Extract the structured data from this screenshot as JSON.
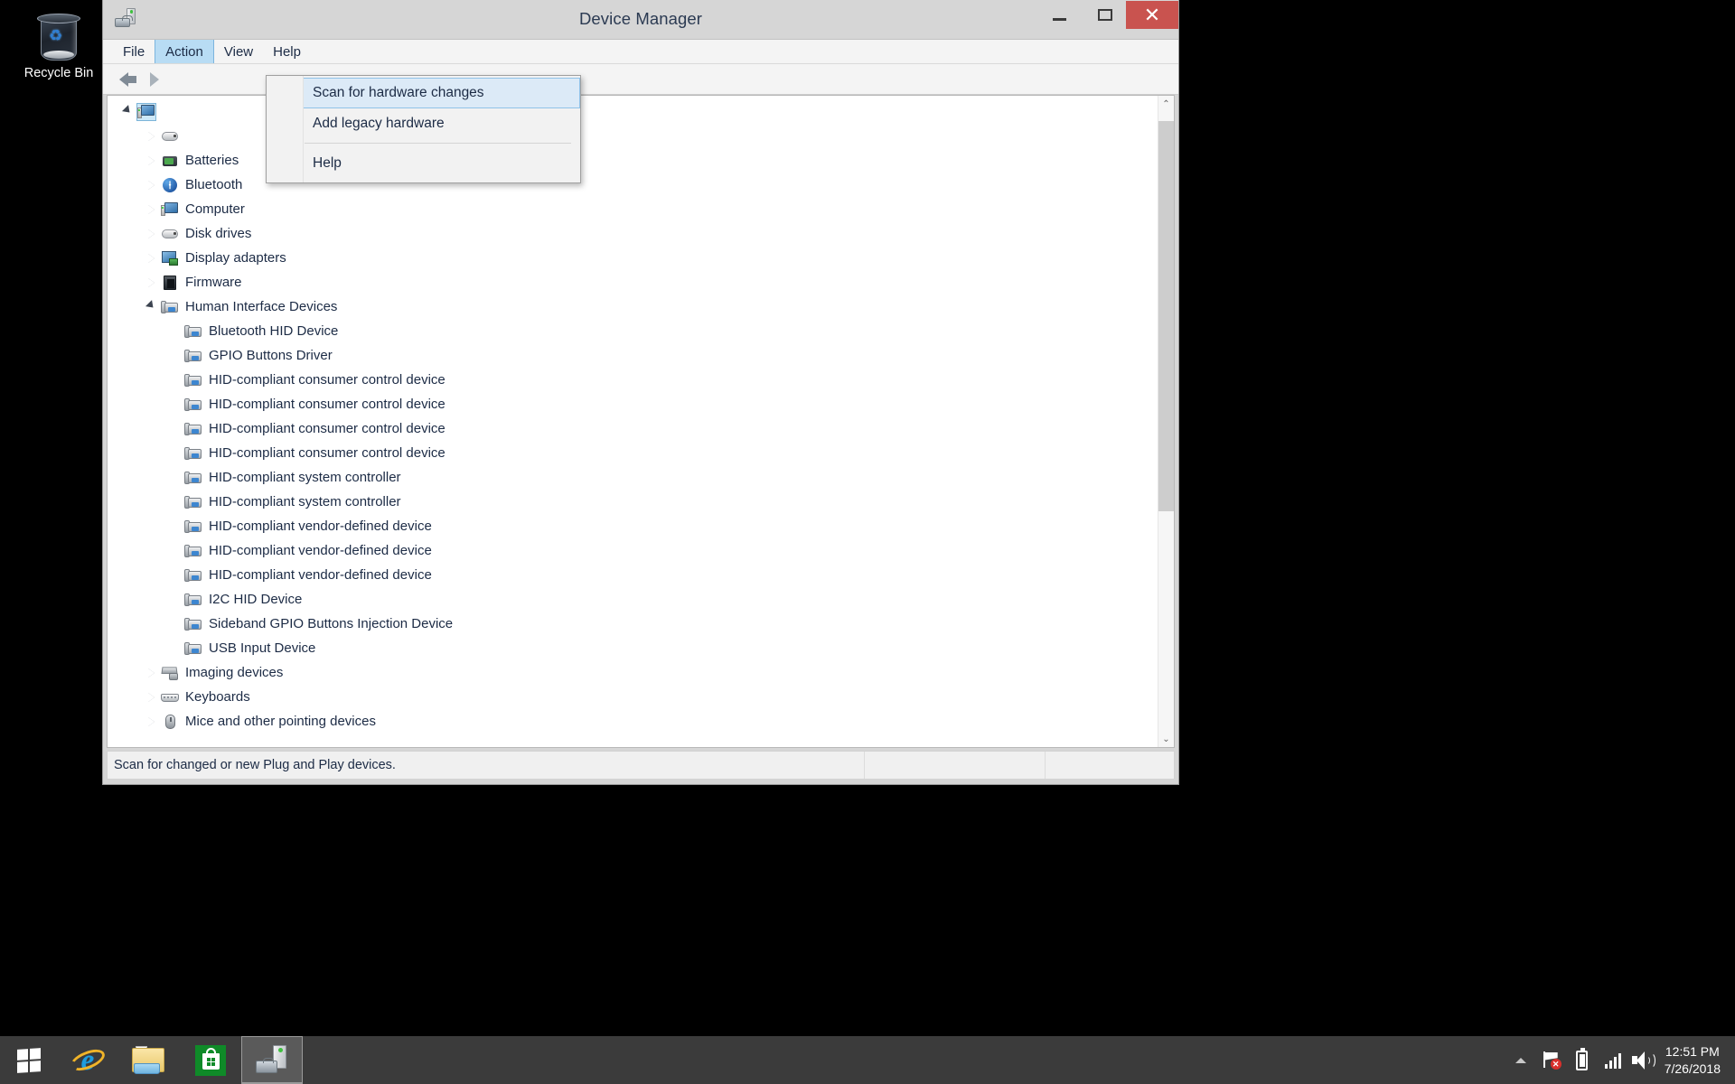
{
  "desktop": {
    "recycle_bin_label": "Recycle Bin",
    "recycle_bin_icon": "recycle-bin-icon"
  },
  "window": {
    "title": "Device Manager",
    "titlebar_icon": "device-manager-icon",
    "controls": {
      "minimize": "–",
      "maximize": "□",
      "close": "✕"
    }
  },
  "menu_bar": {
    "items": [
      {
        "label": "File",
        "open": false
      },
      {
        "label": "Action",
        "open": true
      },
      {
        "label": "View",
        "open": false
      },
      {
        "label": "Help",
        "open": false
      }
    ]
  },
  "action_menu": {
    "items": [
      {
        "label": "Scan for hardware changes",
        "highlighted": true,
        "separator_after": false
      },
      {
        "label": "Add legacy hardware",
        "highlighted": false,
        "separator_after": true
      },
      {
        "label": "Help",
        "highlighted": false,
        "separator_after": false
      }
    ]
  },
  "toolbar": {
    "back_icon": "back-arrow-icon",
    "forward_icon": "forward-arrow-icon"
  },
  "tree": {
    "rows": [
      {
        "label": "",
        "indent": 0,
        "twisty": "open",
        "icon": "computer-root-icon",
        "selected": true,
        "occluded": true
      },
      {
        "label": "",
        "indent": 1,
        "twisty": "closed",
        "icon": "audio-icon",
        "selected": false,
        "occluded": true
      },
      {
        "label": "Batteries",
        "indent": 1,
        "twisty": "closed",
        "icon": "battery-icon",
        "selected": false,
        "occluded": true
      },
      {
        "label": "Bluetooth",
        "indent": 1,
        "twisty": "closed",
        "icon": "bluetooth-icon",
        "selected": false,
        "occluded": false
      },
      {
        "label": "Computer",
        "indent": 1,
        "twisty": "closed",
        "icon": "computer-icon",
        "selected": false,
        "occluded": false
      },
      {
        "label": "Disk drives",
        "indent": 1,
        "twisty": "closed",
        "icon": "disk-drive-icon",
        "selected": false,
        "occluded": false
      },
      {
        "label": "Display adapters",
        "indent": 1,
        "twisty": "closed",
        "icon": "display-adapter-icon",
        "selected": false,
        "occluded": false
      },
      {
        "label": "Firmware",
        "indent": 1,
        "twisty": "closed",
        "icon": "firmware-icon",
        "selected": false,
        "occluded": false
      },
      {
        "label": "Human Interface Devices",
        "indent": 1,
        "twisty": "open",
        "icon": "hid-icon",
        "selected": false,
        "occluded": false
      },
      {
        "label": "Bluetooth HID Device",
        "indent": 2,
        "twisty": "none",
        "icon": "hid-icon",
        "selected": false,
        "occluded": false
      },
      {
        "label": "GPIO Buttons Driver",
        "indent": 2,
        "twisty": "none",
        "icon": "hid-icon",
        "selected": false,
        "occluded": false
      },
      {
        "label": "HID-compliant consumer control device",
        "indent": 2,
        "twisty": "none",
        "icon": "hid-icon",
        "selected": false,
        "occluded": false
      },
      {
        "label": "HID-compliant consumer control device",
        "indent": 2,
        "twisty": "none",
        "icon": "hid-icon",
        "selected": false,
        "occluded": false
      },
      {
        "label": "HID-compliant consumer control device",
        "indent": 2,
        "twisty": "none",
        "icon": "hid-icon",
        "selected": false,
        "occluded": false
      },
      {
        "label": "HID-compliant consumer control device",
        "indent": 2,
        "twisty": "none",
        "icon": "hid-icon",
        "selected": false,
        "occluded": false
      },
      {
        "label": "HID-compliant system controller",
        "indent": 2,
        "twisty": "none",
        "icon": "hid-icon",
        "selected": false,
        "occluded": false
      },
      {
        "label": "HID-compliant system controller",
        "indent": 2,
        "twisty": "none",
        "icon": "hid-icon",
        "selected": false,
        "occluded": false
      },
      {
        "label": "HID-compliant vendor-defined device",
        "indent": 2,
        "twisty": "none",
        "icon": "hid-icon",
        "selected": false,
        "occluded": false
      },
      {
        "label": "HID-compliant vendor-defined device",
        "indent": 2,
        "twisty": "none",
        "icon": "hid-icon",
        "selected": false,
        "occluded": false
      },
      {
        "label": "HID-compliant vendor-defined device",
        "indent": 2,
        "twisty": "none",
        "icon": "hid-icon",
        "selected": false,
        "occluded": false
      },
      {
        "label": "I2C HID Device",
        "indent": 2,
        "twisty": "none",
        "icon": "hid-icon",
        "selected": false,
        "occluded": false
      },
      {
        "label": "Sideband GPIO Buttons Injection Device",
        "indent": 2,
        "twisty": "none",
        "icon": "hid-icon",
        "selected": false,
        "occluded": false
      },
      {
        "label": "USB Input Device",
        "indent": 2,
        "twisty": "none",
        "icon": "hid-icon",
        "selected": false,
        "occluded": false
      },
      {
        "label": "Imaging devices",
        "indent": 1,
        "twisty": "closed",
        "icon": "imaging-icon",
        "selected": false,
        "occluded": false
      },
      {
        "label": "Keyboards",
        "indent": 1,
        "twisty": "closed",
        "icon": "keyboard-icon",
        "selected": false,
        "occluded": false
      },
      {
        "label": "Mice and other pointing devices",
        "indent": 1,
        "twisty": "closed",
        "icon": "mouse-icon",
        "selected": false,
        "occluded": false
      }
    ]
  },
  "scrollbar": {
    "up_arrow": "⌃",
    "down_arrow": "⌄",
    "thumb_top_percent": 1.5,
    "thumb_height_percent": 63
  },
  "status_bar": {
    "message": "Scan for changed or new Plug and Play devices.",
    "panel2": "",
    "panel3": ""
  },
  "taskbar": {
    "start_icon": "windows-start-icon",
    "apps": [
      {
        "name": "internet-explorer",
        "icon": "internet-explorer-icon",
        "active": false
      },
      {
        "name": "file-explorer",
        "icon": "file-explorer-icon",
        "active": false
      },
      {
        "name": "microsoft-store",
        "icon": "microsoft-store-icon",
        "active": false
      },
      {
        "name": "device-manager",
        "icon": "device-manager-icon",
        "active": true
      }
    ],
    "tray": {
      "show_hidden_icons": "show-hidden-icons-chevron",
      "action_center": "action-center-flag-icon",
      "battery": "battery-icon",
      "network": "network-signal-icon",
      "volume": "volume-speaker-icon"
    },
    "clock": {
      "time": "12:51 PM",
      "date": "7/26/2018"
    }
  },
  "colors": {
    "close_button": "#c9534f",
    "menu_highlight": "#b8dcf4",
    "dropdown_highlight": "#dceaf7",
    "taskbar": "#3b3b3b",
    "window_chrome": "#d6d6d6",
    "store_green": "#0f8a28"
  }
}
